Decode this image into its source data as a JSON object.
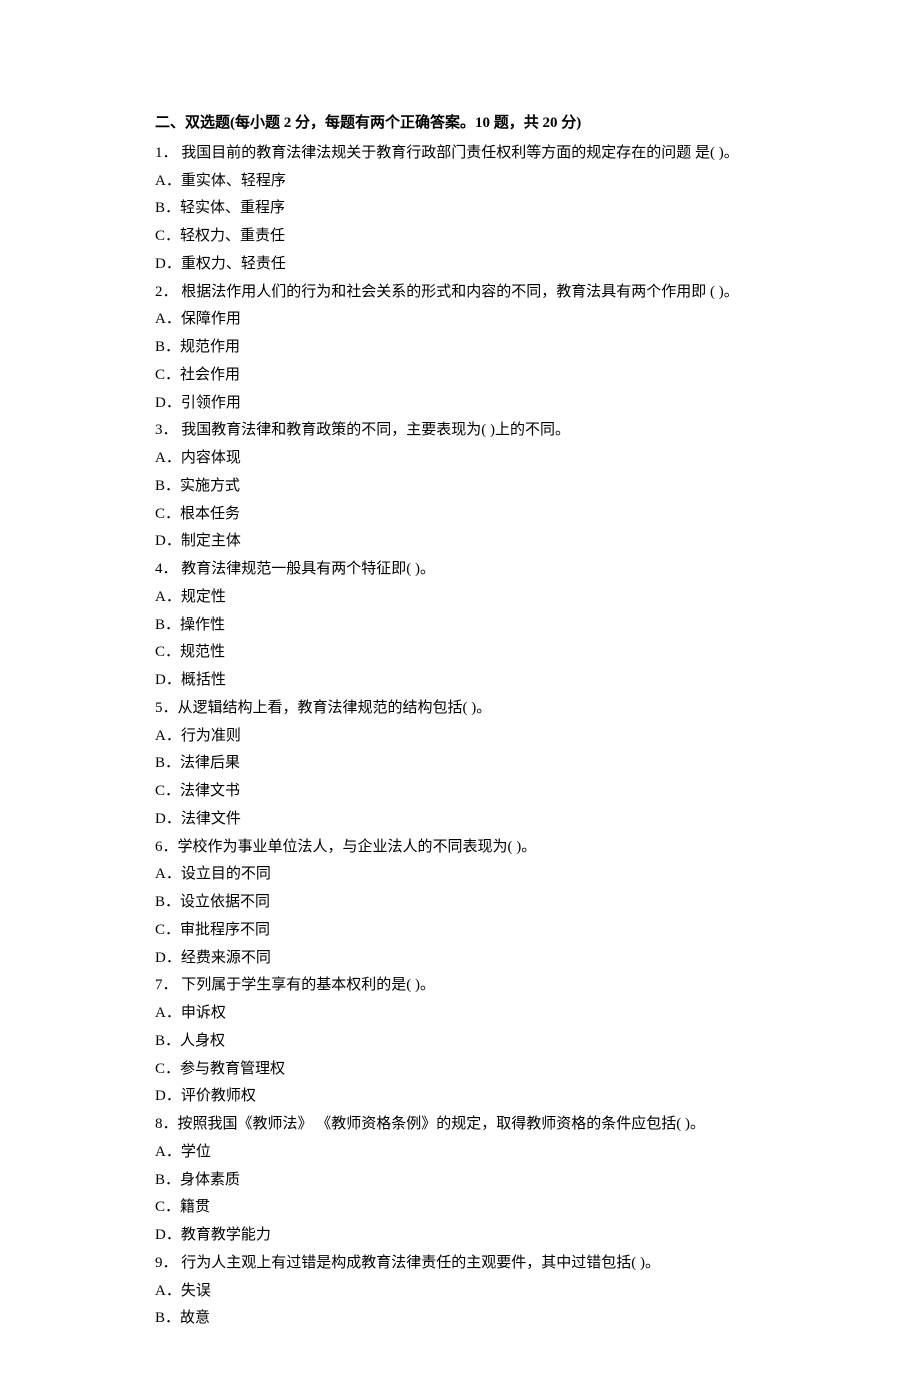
{
  "section": {
    "title": "二、双选题(每小题 2 分，每题有两个正确答案。10 题，共 20 分)"
  },
  "questions": [
    {
      "num": "1．",
      "stem": " 我国目前的教育法律法规关于教育行政部门责任权利等方面的规定存在的问题  是( )。",
      "options": [
        "A．重实体、轻程序",
        "B．轻实体、重程序",
        "C．轻权力、重责任",
        "D．重权力、轻责任"
      ]
    },
    {
      "num": "2．",
      "stem": " 根据法作用人们的行为和社会关系的形式和内容的不同，教育法具有两个作用即  ( )。",
      "options": [
        "A．保障作用",
        "B．规范作用",
        "C．社会作用",
        "D．引领作用"
      ]
    },
    {
      "num": "3．",
      "stem": " 我国教育法律和教育政策的不同，主要表现为( )上的不同。",
      "options": [
        "A．内容体现",
        "B．实施方式",
        "C．根本任务",
        "D．制定主体"
      ]
    },
    {
      "num": "4．",
      "stem": " 教育法律规范一般具有两个特征即( )。",
      "options": [
        "A．规定性",
        "B．操作性",
        "C．规范性",
        "D．概括性"
      ]
    },
    {
      "num": "5．",
      "stem": "从逻辑结构上看，教育法律规范的结构包括( )。",
      "options": [
        "A．行为准则",
        "B．法律后果",
        "C．法律文书",
        "D．法律文件"
      ]
    },
    {
      "num": "6．",
      "stem": "学校作为事业单位法人，与企业法人的不同表现为( )。",
      "options": [
        "A．设立目的不同",
        "B．设立依据不同",
        "C．审批程序不同",
        "D．经费来源不同"
      ]
    },
    {
      "num": "7．",
      "stem": " 下列属于学生享有的基本权利的是( )。",
      "options": [
        "A．申诉权",
        "B．人身权",
        "C．参与教育管理权",
        "D．评价教师权"
      ]
    },
    {
      "num": "8．",
      "stem": "按照我国《教师法》 《教师资格条例》的规定，取得教师资格的条件应包括( )。",
      "options": [
        "A．学位",
        "B．身体素质",
        "C．籍贯",
        "D．教育教学能力"
      ]
    },
    {
      "num": "9．",
      "stem": " 行为人主观上有过错是构成教育法律责任的主观要件，其中过错包括( )。",
      "options": [
        "A．失误",
        "B．故意"
      ]
    }
  ]
}
